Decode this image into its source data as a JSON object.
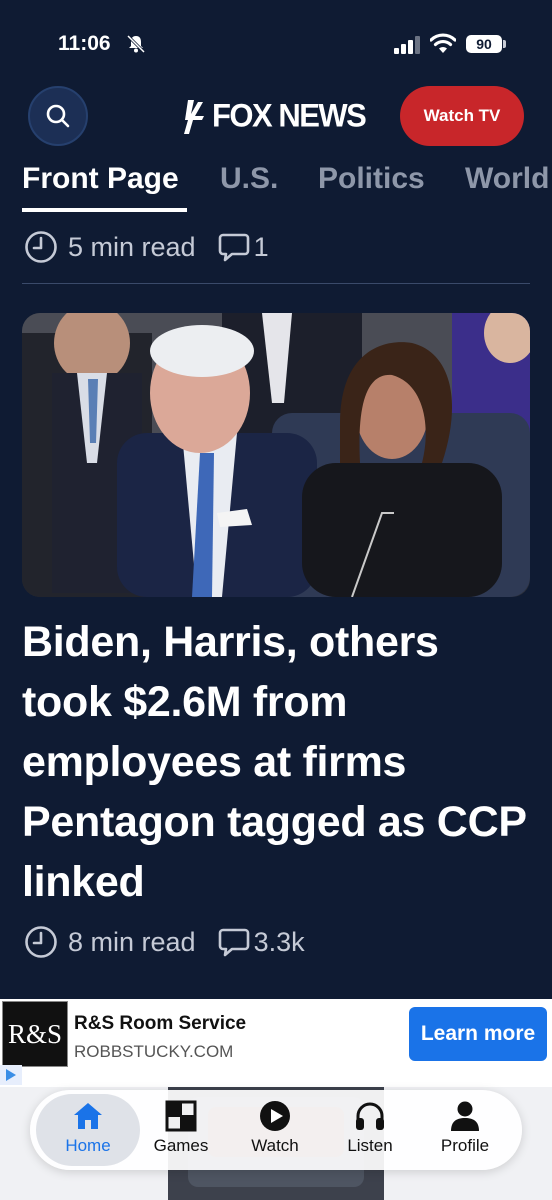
{
  "status_bar": {
    "time": "11:06",
    "battery": "90"
  },
  "header": {
    "logo_text": "FOX NEWS",
    "watch_tv_label": "Watch TV"
  },
  "tabs": [
    {
      "label": "Front Page",
      "active": true
    },
    {
      "label": "U.S.",
      "active": false
    },
    {
      "label": "Politics",
      "active": false
    },
    {
      "label": "World",
      "active": false
    }
  ],
  "top_story_meta": {
    "read_time": "5 min read",
    "comments": "1"
  },
  "article": {
    "headline": "Biden, Harris, others took $2.6M from employees at firms Pentagon tagged as CCP linked",
    "read_time": "8 min read",
    "comments": "3.3k"
  },
  "ad": {
    "logo_text": "R&S",
    "title": "R&S Room Service",
    "url": "ROBBSTUCKY.COM",
    "cta": "Learn more"
  },
  "bottom_nav": [
    {
      "label": "Home",
      "icon": "home-icon",
      "active": true
    },
    {
      "label": "Games",
      "icon": "games-icon",
      "active": false
    },
    {
      "label": "Watch",
      "icon": "play-icon",
      "active": false
    },
    {
      "label": "Listen",
      "icon": "headphones-icon",
      "active": false
    },
    {
      "label": "Profile",
      "icon": "profile-icon",
      "active": false
    }
  ],
  "colors": {
    "background": "#0f1b33",
    "accent_red": "#c8262a",
    "link_blue": "#1a73e8"
  }
}
